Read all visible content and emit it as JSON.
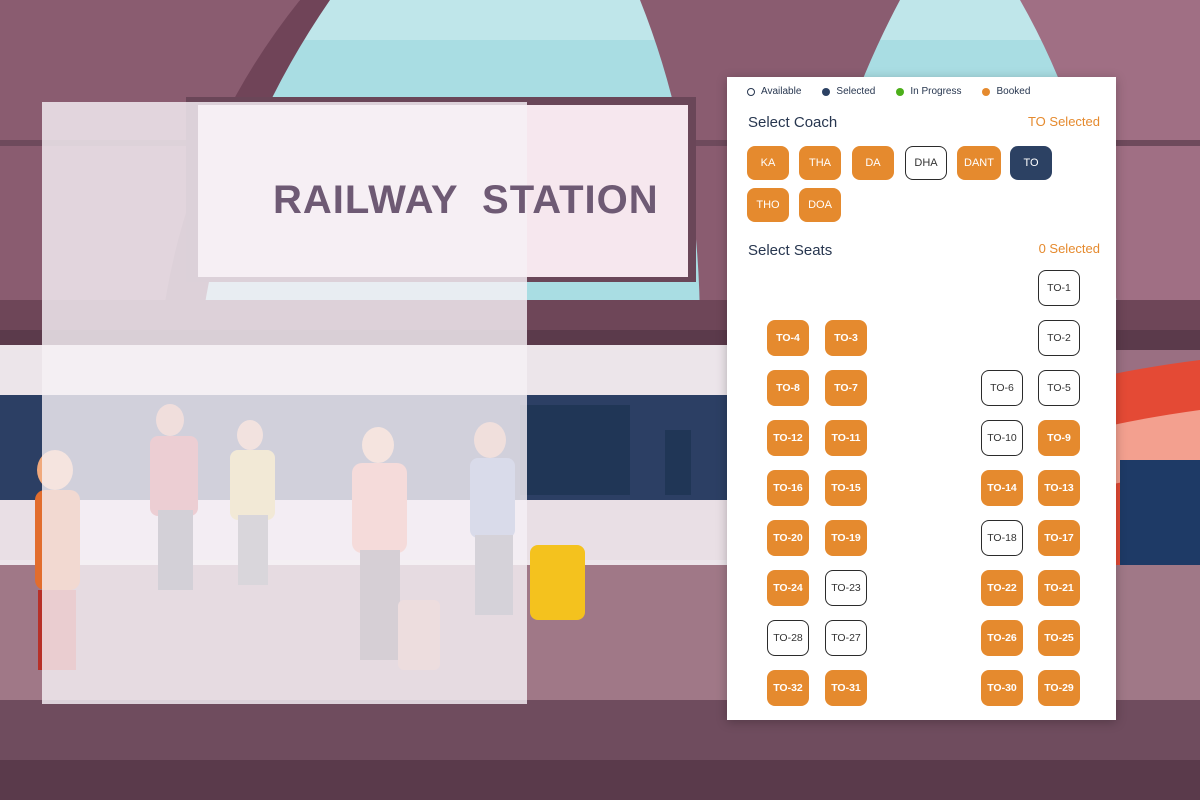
{
  "background": {
    "sign_text": "RAILWAY  STATION"
  },
  "legend": [
    {
      "label": "Available",
      "status": "available",
      "color": "#ffffff"
    },
    {
      "label": "Selected",
      "status": "selected",
      "color": "#2c4163"
    },
    {
      "label": "In Progress",
      "status": "in-progress",
      "color": "#4caf1a"
    },
    {
      "label": "Booked",
      "status": "booked",
      "color": "#e58a2e"
    }
  ],
  "coach_section": {
    "title": "Select Coach",
    "selected_text": "TO Selected",
    "coaches": [
      {
        "label": "KA",
        "status": "booked"
      },
      {
        "label": "THA",
        "status": "booked"
      },
      {
        "label": "DA",
        "status": "booked"
      },
      {
        "label": "DHA",
        "status": "available"
      },
      {
        "label": "DANT",
        "status": "booked"
      },
      {
        "label": "TO",
        "status": "selected"
      },
      {
        "label": "THO",
        "status": "booked"
      },
      {
        "label": "DOA",
        "status": "booked"
      }
    ]
  },
  "seat_section": {
    "title": "Select Seats",
    "selected_text": "0 Selected",
    "rows": [
      [
        null,
        null,
        null,
        {
          "label": "TO-1",
          "status": "available"
        }
      ],
      [
        {
          "label": "TO-4",
          "status": "booked"
        },
        {
          "label": "TO-3",
          "status": "booked"
        },
        null,
        {
          "label": "TO-2",
          "status": "available"
        }
      ],
      [
        {
          "label": "TO-8",
          "status": "booked"
        },
        {
          "label": "TO-7",
          "status": "booked"
        },
        {
          "label": "TO-6",
          "status": "available"
        },
        {
          "label": "TO-5",
          "status": "available"
        }
      ],
      [
        {
          "label": "TO-12",
          "status": "booked"
        },
        {
          "label": "TO-11",
          "status": "booked"
        },
        {
          "label": "TO-10",
          "status": "available"
        },
        {
          "label": "TO-9",
          "status": "booked"
        }
      ],
      [
        {
          "label": "TO-16",
          "status": "booked"
        },
        {
          "label": "TO-15",
          "status": "booked"
        },
        {
          "label": "TO-14",
          "status": "booked"
        },
        {
          "label": "TO-13",
          "status": "booked"
        }
      ],
      [
        {
          "label": "TO-20",
          "status": "booked"
        },
        {
          "label": "TO-19",
          "status": "booked"
        },
        {
          "label": "TO-18",
          "status": "available"
        },
        {
          "label": "TO-17",
          "status": "booked"
        }
      ],
      [
        {
          "label": "TO-24",
          "status": "booked"
        },
        {
          "label": "TO-23",
          "status": "available"
        },
        {
          "label": "TO-22",
          "status": "booked"
        },
        {
          "label": "TO-21",
          "status": "booked"
        }
      ],
      [
        {
          "label": "TO-28",
          "status": "available"
        },
        {
          "label": "TO-27",
          "status": "available"
        },
        {
          "label": "TO-26",
          "status": "booked"
        },
        {
          "label": "TO-25",
          "status": "booked"
        }
      ],
      [
        {
          "label": "TO-32",
          "status": "booked"
        },
        {
          "label": "TO-31",
          "status": "booked"
        },
        {
          "label": "TO-30",
          "status": "booked"
        },
        {
          "label": "TO-29",
          "status": "booked"
        }
      ]
    ]
  }
}
